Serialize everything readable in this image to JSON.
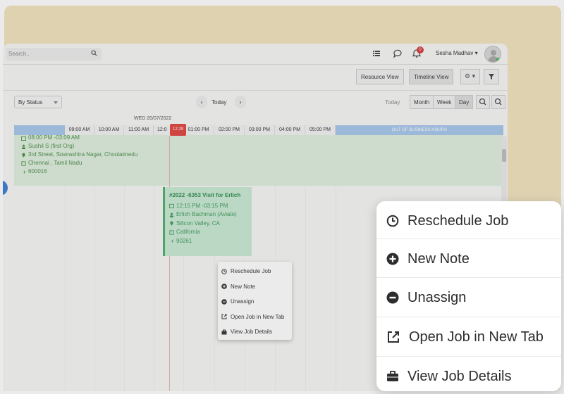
{
  "topbar": {
    "search_placeholder": "Search..",
    "user_name": "Sesha Madhav",
    "notification_count": "0"
  },
  "views": {
    "resource": "Resource View",
    "timeline": "Timeline View"
  },
  "toolbar": {
    "status_filter": "By Status",
    "today": "Today",
    "today_right": "Today",
    "month": "Month",
    "week": "Week",
    "day": "Day"
  },
  "timeline": {
    "date": "WED 20/07/2022",
    "times": [
      "09:00 AM",
      "10:00 AM",
      "11:00 AM",
      "12:0",
      "01:00 PM",
      "02:00 PM",
      "03:00 PM",
      "04:00 PM",
      "05:00 PM"
    ],
    "now": "12:29",
    "out_of_hours": "OUT OF BUSINESS HOURS"
  },
  "job1": {
    "time": "08:00 PM -03:09 AM",
    "person": "Sushil S (first Org)",
    "address": "3rd Street, Sowrashtra Nagar, Choolaimedu",
    "city": "Chennai , Tamil Nadu",
    "zip": "600016"
  },
  "job2": {
    "title": "#2022 -6353 Visit for Erlich",
    "time": "12:15 PM -03:15 PM",
    "person": "Erlich Bachman (Aviato)",
    "city": "Silicon Valley, CA",
    "state": "California",
    "zip": "90261"
  },
  "context_menu": {
    "reschedule": "Reschedule Job",
    "new_note": "New Note",
    "unassign": "Unassign",
    "open_tab": "Open Job in New Tab",
    "view_details": "View Job Details"
  },
  "colors": {
    "accent_green": "#4caf6a",
    "out_of_hours_blue": "#a7c6ec",
    "now_red": "#e0433f",
    "background_cream": "#f1e3bd"
  }
}
